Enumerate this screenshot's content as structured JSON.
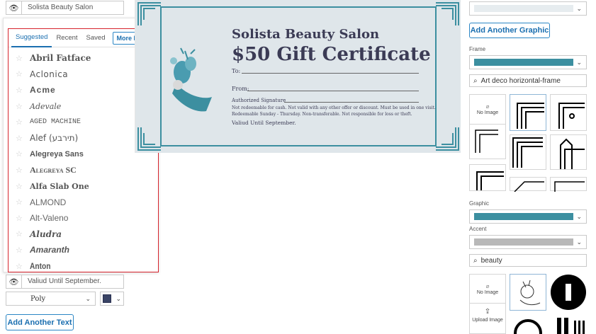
{
  "left": {
    "title_field": "Solista Beauty Salon",
    "bottom_field": "Valiud Until September.",
    "font_select": "Poly",
    "add_text_button": "Add Another Text",
    "font_popup": {
      "close": "×",
      "tabs": [
        "Suggested",
        "Recent",
        "Saved"
      ],
      "more_fonts": "More Fonts",
      "fonts": [
        "Abril Fatface",
        "Aclonica",
        "Acme",
        "Adevale",
        "AGED MACHINE",
        "Alef (תירבע)",
        "Alegreya Sans",
        "Alegreya SC",
        "Alfa Slab One",
        "ALMOND",
        "Alt-Valeno",
        "Aludra",
        "Amaranth",
        "Anton"
      ]
    }
  },
  "certificate": {
    "business": "Solista Beauty Salon",
    "title": "$50 Gift Certificate",
    "to_label": "To:",
    "from_label": "From:",
    "signature_label": "Authorized Signature",
    "fine_print_1": "Not redeemable for cash. Not valid with any other offer or discount. Must be used in one visit.",
    "fine_print_2": "Redeemable Sunday - Thursday. Non-transferable. Not responsible for loss or theft.",
    "valid": "Valiud Until September.",
    "accent_color": "#3c8fa0"
  },
  "right": {
    "add_graphic_button": "Add Another Graphic",
    "frame_label": "Frame",
    "frame_search": "Art deco horizontal-frame",
    "no_image": "No Image",
    "graphic_label": "Graphic",
    "accent_label": "Accent",
    "graphic_search": "beauty",
    "upload_image": "Upload Image",
    "colors": {
      "teal": "#3c8fa0",
      "gray": "#b8b8b8",
      "light": "#e6ecef"
    }
  }
}
